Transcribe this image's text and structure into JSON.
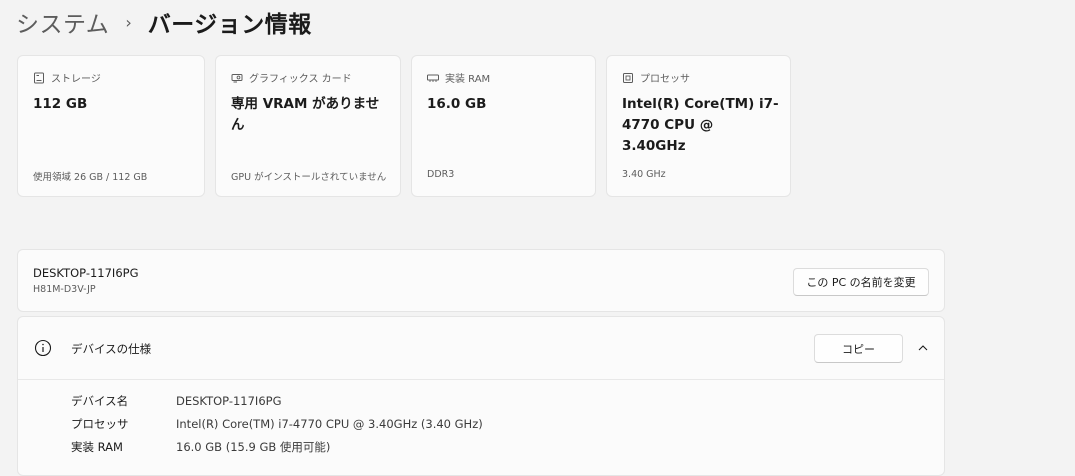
{
  "breadcrumb": {
    "parent": "システム",
    "separator": "›",
    "current": "バージョン情報"
  },
  "cards": [
    {
      "icon": "storage-icon",
      "label": "ストレージ",
      "value": "112 GB",
      "sub": "使用領域 26 GB / 112 GB"
    },
    {
      "icon": "graphics-card-icon",
      "label": "グラフィックス カード",
      "value": "専用 VRAM がありません",
      "sub": "GPU がインストールされていません"
    },
    {
      "icon": "ram-icon",
      "label": "実装 RAM",
      "value": "16.0 GB",
      "sub": "DDR3"
    },
    {
      "icon": "processor-icon",
      "label": "プロセッサ",
      "value": "Intel(R) Core(TM) i7-4770 CPU @ 3.40GHz",
      "sub": "3.40 GHz"
    }
  ],
  "device": {
    "name": "DESKTOP-117I6PG",
    "model": "H81M-D3V-JP",
    "rename_label": "この PC の名前を変更"
  },
  "specs": {
    "title": "デバイスの仕様",
    "copy_label": "コピー",
    "rows": [
      {
        "key": "デバイス名",
        "value": "DESKTOP-117I6PG"
      },
      {
        "key": "プロセッサ",
        "value": "Intel(R) Core(TM) i7-4770 CPU @ 3.40GHz (3.40 GHz)"
      },
      {
        "key": "実装 RAM",
        "value": "16.0 GB (15.9 GB 使用可能)"
      }
    ]
  },
  "colors": {
    "background": "#f3f3f3",
    "card": "#fbfbfb",
    "border": "#e5e5e5",
    "text_primary": "#1b1b1b",
    "text_secondary": "#5c5c5c"
  }
}
